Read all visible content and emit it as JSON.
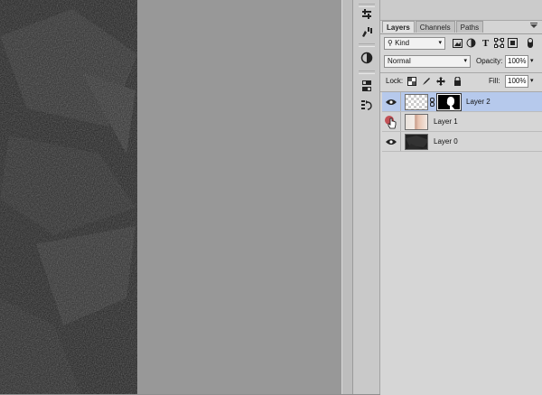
{
  "panel": {
    "tabs": [
      {
        "label": "Layers",
        "active": true
      },
      {
        "label": "Channels",
        "active": false
      },
      {
        "label": "Paths",
        "active": false
      }
    ],
    "filter": {
      "selected": "Kind"
    },
    "blend_mode": {
      "selected": "Normal"
    },
    "opacity": {
      "label": "Opacity:",
      "value": "100%"
    },
    "lock": {
      "label": "Lock:"
    },
    "fill": {
      "label": "Fill:",
      "value": "100%"
    },
    "layers": [
      {
        "name": "Layer 2",
        "selected": true,
        "visible": true,
        "has_mask": true
      },
      {
        "name": "Layer 1",
        "selected": false,
        "visible": true,
        "has_mask": false
      },
      {
        "name": "Layer 0",
        "selected": false,
        "visible": true,
        "has_mask": false
      }
    ]
  },
  "icons": {
    "filter": [
      "image-filter-icon",
      "adjustment-filter-icon",
      "type-filter-icon",
      "shape-filter-icon",
      "smart-object-filter-icon",
      "filter-toggle-icon"
    ],
    "lock": [
      "lock-transparent-pixels-icon",
      "lock-image-pixels-icon",
      "lock-position-icon",
      "lock-all-icon"
    ],
    "tools": [
      "adjustments-icon",
      "brush-presets-icon",
      "color-wheel-icon",
      "properties-icon",
      "history-icon"
    ]
  },
  "colors": {
    "selection": "#b6c9ec",
    "canvas": "#989898",
    "panel": "#d6d6d6"
  }
}
